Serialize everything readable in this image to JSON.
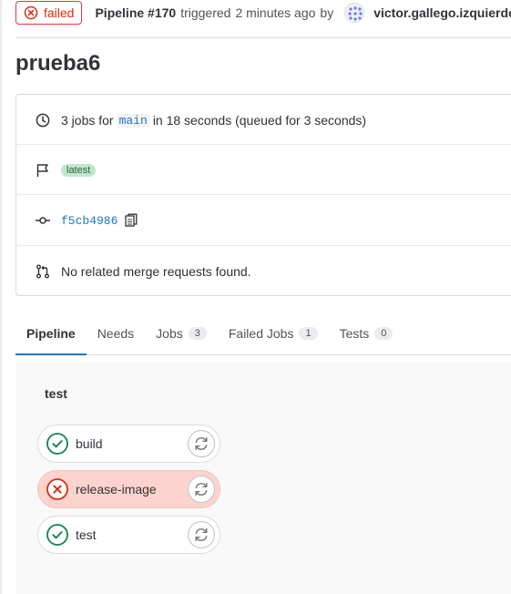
{
  "header": {
    "status_label": "failed",
    "pipeline_ref": "Pipeline #170",
    "triggered_text": "triggered",
    "time_ago": "2 minutes ago",
    "by_text": "by",
    "author": "victor.gallego.izquierdo"
  },
  "title": "prueba6",
  "info": {
    "jobs_prefix": "3 jobs for",
    "branch": "main",
    "jobs_suffix": "in 18 seconds (queued for 3 seconds)",
    "tag_label": "latest",
    "commit_sha": "f5cb4986",
    "merge_requests_text": "No related merge requests found."
  },
  "tabs": [
    {
      "label": "Pipeline",
      "count": null
    },
    {
      "label": "Needs",
      "count": null
    },
    {
      "label": "Jobs",
      "count": "3"
    },
    {
      "label": "Failed Jobs",
      "count": "1"
    },
    {
      "label": "Tests",
      "count": "0"
    }
  ],
  "stage": {
    "name": "test",
    "jobs": [
      {
        "name": "build",
        "status": "success"
      },
      {
        "name": "release-image",
        "status": "failed"
      },
      {
        "name": "test",
        "status": "success"
      }
    ]
  },
  "colors": {
    "failed": "#dd2b0e",
    "success": "#108548",
    "link": "#1f75cb",
    "tab_active": "#1f75cb"
  },
  "icons": {
    "status_failed": "status-failed-icon",
    "clock": "clock-icon",
    "flag": "flag-icon",
    "commit": "commit-icon",
    "merge_request": "merge-request-icon",
    "copy": "copy-icon",
    "retry": "retry-icon"
  }
}
